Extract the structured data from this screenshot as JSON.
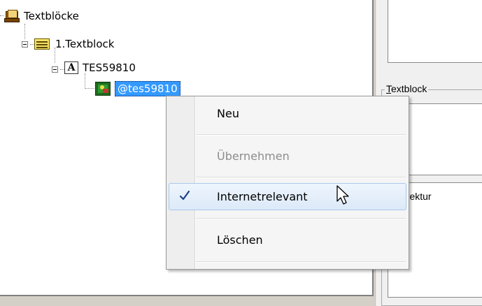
{
  "tree": {
    "root": {
      "label": "Textblöcke",
      "icon": "book-icon"
    },
    "child": {
      "label": "1.Textblock",
      "icon": "note-icon"
    },
    "grandchild": {
      "label": "TES59810",
      "icon": "letter-a-icon",
      "icon_text": "A"
    },
    "leaf": {
      "label": "@tes59810",
      "icon": "image-icon",
      "selected": true
    }
  },
  "right_panel": {
    "group_label_underlined": "T",
    "group_label_rest": "extblock",
    "memo_text": "Korrektur"
  },
  "context_menu": {
    "items": [
      {
        "label": "Neu",
        "enabled": true,
        "checked": false
      },
      {
        "label": "Übernehmen",
        "enabled": false,
        "checked": false
      },
      {
        "label": "Internetrelevant",
        "enabled": true,
        "checked": true,
        "hovered": true
      },
      {
        "label": "Löschen",
        "enabled": true,
        "checked": false
      }
    ],
    "check_icon": "checkmark-icon"
  },
  "colors": {
    "selection": "#3399ff",
    "menu_highlight_border": "#a9c8ec",
    "check_color": "#1c3f8a"
  }
}
